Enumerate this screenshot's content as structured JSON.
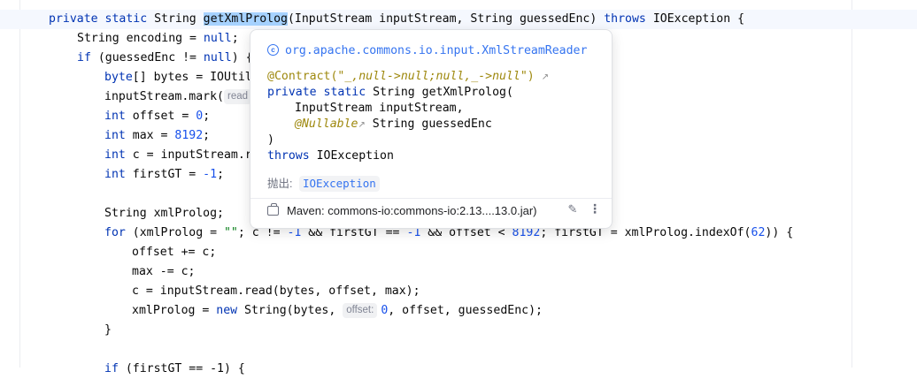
{
  "editor": {
    "lines": [
      {
        "parts": [
          [
            "kw",
            "private static "
          ],
          [
            "",
            "String "
          ],
          [
            "sel",
            "getXmlProlog"
          ],
          [
            "",
            "(InputStream inputStream, String guessedEnc) "
          ],
          [
            "kw",
            "throws "
          ],
          [
            "",
            "IOException {"
          ]
        ]
      },
      {
        "parts": [
          [
            "",
            "String encoding = "
          ],
          [
            "kw",
            "null"
          ],
          [
            "",
            ";"
          ]
        ]
      },
      {
        "parts": [
          [
            "kw",
            "if "
          ],
          [
            "",
            "(guessedEnc != "
          ],
          [
            "kw",
            "null"
          ],
          [
            "",
            ") {"
          ]
        ]
      },
      {
        "parts": [
          [
            "kw",
            "byte"
          ],
          [
            "",
            "[] bytes = IOUtil"
          ]
        ]
      },
      {
        "parts": [
          [
            "",
            "inputStream.mark("
          ],
          [
            "hint",
            "read"
          ]
        ]
      },
      {
        "parts": [
          [
            "kw",
            "int "
          ],
          [
            "",
            "offset = "
          ],
          [
            "num",
            "0"
          ],
          [
            "",
            ";"
          ]
        ]
      },
      {
        "parts": [
          [
            "kw",
            "int "
          ],
          [
            "",
            "max = "
          ],
          [
            "num",
            "8192"
          ],
          [
            "",
            ";"
          ]
        ]
      },
      {
        "parts": [
          [
            "kw",
            "int "
          ],
          [
            "",
            "c = inputStream.r"
          ]
        ]
      },
      {
        "parts": [
          [
            "kw",
            "int "
          ],
          [
            "",
            "firstGT = "
          ],
          [
            "num",
            "-1"
          ],
          [
            "",
            ";"
          ]
        ]
      },
      {
        "parts": []
      },
      {
        "parts": [
          [
            "",
            "String xmlProlog;"
          ]
        ]
      },
      {
        "parts": [
          [
            "kw",
            "for "
          ],
          [
            "",
            "(xmlProlog = "
          ],
          [
            "str",
            "\"\""
          ],
          [
            "",
            "; c != "
          ],
          [
            "num",
            "-1"
          ],
          [
            "",
            " && firstGT == "
          ],
          [
            "num",
            "-1"
          ],
          [
            "",
            " && offset < "
          ],
          [
            "num",
            "8192"
          ],
          [
            "",
            "; firstGT = xmlProlog.indexOf("
          ],
          [
            "num",
            "62"
          ],
          [
            "",
            ")) {"
          ]
        ]
      },
      {
        "parts": [
          [
            "",
            "offset += c;"
          ]
        ]
      },
      {
        "parts": [
          [
            "",
            "max -= c;"
          ]
        ]
      },
      {
        "parts": [
          [
            "",
            "c = inputStream.read(bytes, offset, max);"
          ]
        ]
      },
      {
        "parts": [
          [
            "",
            "xmlProlog = "
          ],
          [
            "kw",
            "new "
          ],
          [
            "",
            "String(bytes, "
          ],
          [
            "hint",
            "offset:"
          ],
          [
            "num",
            "0"
          ],
          [
            "",
            ", offset, guessedEnc);"
          ]
        ]
      },
      {
        "parts": [
          [
            "",
            "}"
          ]
        ]
      },
      {
        "parts": []
      },
      {
        "parts": [
          [
            "kw",
            "if "
          ],
          [
            "",
            "(firstGT == -1) {"
          ]
        ]
      }
    ]
  },
  "popup": {
    "package": "org.apache.commons.io.input.XmlStreamReader",
    "package_icon": "class-circle-icon",
    "annotation": "@Contract(",
    "annotation_value": "\"_,null->null;null,_->null\"",
    "annotation_close": ")",
    "ext_link_glyph": "↗",
    "sig_keywords": "private static ",
    "sig_type": "String ",
    "sig_name": "getXmlProlog",
    "sig_open": "(",
    "param1": "InputStream inputStream,",
    "param2_annotation": "@Nullable",
    "param2": " String guessedEnc",
    "sig_close": ")",
    "throws_kw": "throws",
    "throws_type": " IOException",
    "throws_label": "抛出:",
    "throws_chip": "IOException",
    "jar_text": "Maven: commons-io:commons-io:2.13....13.0.jar)",
    "edit_glyph": "✎",
    "more_glyph": "⋮"
  },
  "colors": {
    "keyword": "#0033b3",
    "number": "#1750eb",
    "string": "#067d17",
    "link": "#3574f0",
    "annotation": "#9e880d"
  }
}
